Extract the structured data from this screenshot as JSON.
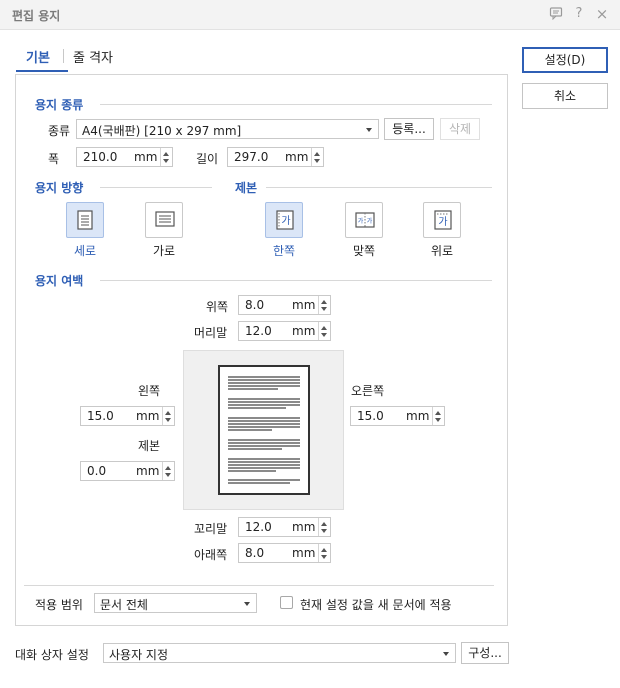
{
  "window": {
    "title": "편집 용지",
    "icons": [
      "chat-icon",
      "help-icon",
      "close-icon"
    ],
    "help_glyph": "?",
    "close_glyph": "×"
  },
  "tabs": [
    {
      "label": "기본",
      "active": true
    },
    {
      "label": "줄 격자",
      "active": false
    }
  ],
  "buttons": {
    "ok_label": "설정(D)",
    "cancel_label": "취소"
  },
  "paper_type": {
    "section_title": "용지 종류",
    "type_label": "종류",
    "type_value": "A4(국배판) [210 x 297 mm]",
    "register_label": "등록...",
    "delete_label": "삭제",
    "width_label": "폭",
    "width_value": "210.0",
    "height_label": "길이",
    "height_value": "297.0",
    "unit": "mm"
  },
  "orientation": {
    "section_title": "용지 방향",
    "options": [
      {
        "label": "세로",
        "selected": true
      },
      {
        "label": "가로",
        "selected": false
      }
    ]
  },
  "binding": {
    "section_title": "제본",
    "options": [
      {
        "label": "한쪽",
        "selected": true
      },
      {
        "label": "맞쪽",
        "selected": false
      },
      {
        "label": "위로",
        "selected": false
      }
    ],
    "glyph": "가"
  },
  "margins": {
    "section_title": "용지 여백",
    "unit": "mm",
    "top": {
      "label": "위쪽",
      "value": "8.0"
    },
    "header": {
      "label": "머리말",
      "value": "12.0"
    },
    "left": {
      "label": "왼쪽",
      "value": "15.0"
    },
    "right": {
      "label": "오른쪽",
      "value": "15.0"
    },
    "gutter": {
      "label": "제본",
      "value": "0.0"
    },
    "footer": {
      "label": "꼬리말",
      "value": "12.0"
    },
    "bottom": {
      "label": "아래쪽",
      "value": "8.0"
    }
  },
  "apply": {
    "label": "적용 범위",
    "value": "문서 전체",
    "checkbox_label": "현재 설정 값을 새 문서에 적용",
    "checked": false
  },
  "dialog_settings": {
    "label": "대화 상자 설정",
    "value": "사용자 지정",
    "configure_label": "구성..."
  },
  "colors": {
    "accent": "#2f5fb5",
    "selected_bg": "#dbe6f7"
  }
}
